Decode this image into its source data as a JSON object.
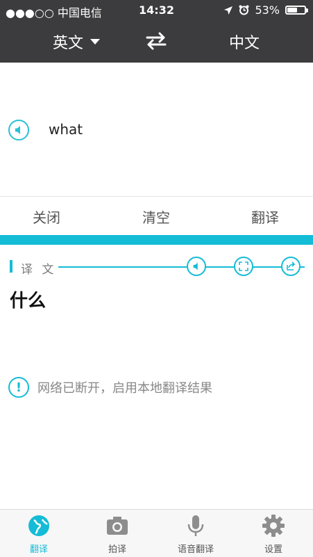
{
  "status_bar": {
    "carrier": "●●●○○ 中国电信",
    "time": "14:32",
    "battery_text": "53%",
    "battery_level": 0.53
  },
  "languages": {
    "source": "英文",
    "target": "中文"
  },
  "input": {
    "text": "what"
  },
  "actions": {
    "close_label": "关闭",
    "clear_label": "清空",
    "translate_label": "翻译"
  },
  "result": {
    "label": "译 文",
    "text": "什么",
    "notice": "网络已断开，启用本地翻译结果"
  },
  "tabs": [
    {
      "label": "翻译",
      "icon": "globe-icon",
      "active": true
    },
    {
      "label": "拍译",
      "icon": "camera-icon",
      "active": false
    },
    {
      "label": "语音翻译",
      "icon": "microphone-icon",
      "active": false
    },
    {
      "label": "设置",
      "icon": "gear-icon",
      "active": false
    }
  ],
  "colors": {
    "accent": "#14bcd6",
    "header_bg": "#3c3c3e"
  }
}
